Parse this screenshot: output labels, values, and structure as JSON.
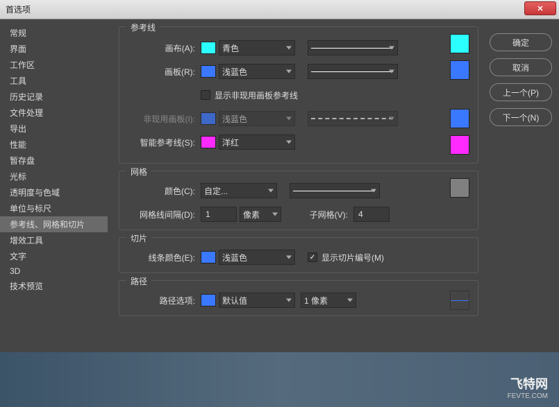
{
  "window": {
    "title": "首选项"
  },
  "sidebar": {
    "items": [
      {
        "label": "常规"
      },
      {
        "label": "界面"
      },
      {
        "label": "工作区"
      },
      {
        "label": "工具"
      },
      {
        "label": "历史记录"
      },
      {
        "label": "文件处理"
      },
      {
        "label": "导出"
      },
      {
        "label": "性能"
      },
      {
        "label": "暂存盘"
      },
      {
        "label": "光标"
      },
      {
        "label": "透明度与色域"
      },
      {
        "label": "单位与标尺"
      },
      {
        "label": "参考线、网格和切片",
        "active": true
      },
      {
        "label": "增效工具"
      },
      {
        "label": "文字"
      },
      {
        "label": "3D"
      },
      {
        "label": "技术预览"
      }
    ]
  },
  "buttons": {
    "ok": "确定",
    "cancel": "取消",
    "prev": "上一个(P)",
    "next": "下一个(N)"
  },
  "guides": {
    "title": "参考线",
    "canvas": {
      "label": "画布(A):",
      "color_name": "青色",
      "swatch": "#2cffff"
    },
    "artboard": {
      "label": "画板(R):",
      "color_name": "浅蓝色",
      "swatch": "#3a78ff"
    },
    "inactive_check": "显示非现用画板参考线",
    "inactive": {
      "label": "非现用画板(I):",
      "color_name": "浅蓝色",
      "swatch": "#3a78ff"
    },
    "smart": {
      "label": "智能参考线(S):",
      "color_name": "洋红",
      "swatch": "#ff2aff"
    }
  },
  "grid": {
    "title": "网格",
    "color": {
      "label": "颜色(C):",
      "value": "自定...",
      "swatch": "#808080"
    },
    "spacing": {
      "label": "网格线间隔(D):",
      "value": "1",
      "unit": "像素"
    },
    "sub": {
      "label": "子网格(V):",
      "value": "4"
    }
  },
  "slice": {
    "title": "切片",
    "linecolor": {
      "label": "线条颜色(E):",
      "color_name": "浅蓝色",
      "swatch": "#3a78ff"
    },
    "shownum": "显示切片编号(M)"
  },
  "path": {
    "title": "路径",
    "opt": {
      "label": "路径选项:",
      "color_name": "默认值",
      "swatch": "#3a78ff",
      "width": "1 像素"
    }
  },
  "watermark": {
    "text": "飞特网",
    "sub": "FEVTE.COM"
  }
}
